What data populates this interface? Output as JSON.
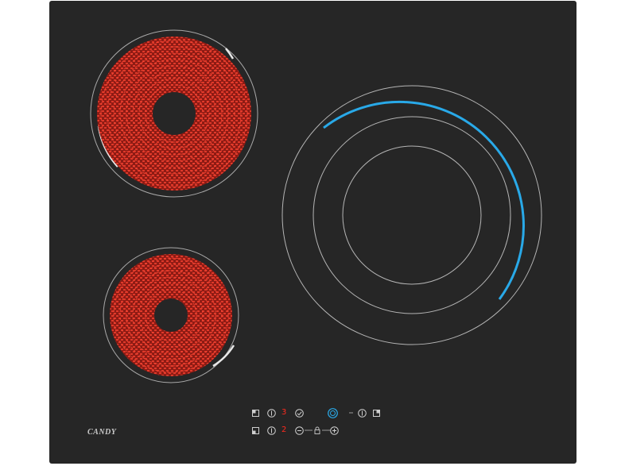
{
  "brand": {
    "logo_text": "CANDY"
  },
  "zones": {
    "top_left": {
      "state": "heating",
      "color": "#d0281c"
    },
    "bottom_left": {
      "state": "heating",
      "color": "#d0281c"
    },
    "right": {
      "state": "off",
      "indicator_color": "#29a9e8"
    }
  },
  "controls": {
    "row_top": {
      "level_digit": "3"
    },
    "row_bottom": {
      "level_digit": "2"
    }
  },
  "icons": [
    "zone-select-icon",
    "power-icon",
    "timer-check-icon",
    "zone-selected-icon",
    "minus-icon",
    "lock-icon",
    "plus-icon"
  ],
  "colors": {
    "glass": "#262626",
    "zone_ring": "#b5b5b5",
    "heat": "#d0281c",
    "accent": "#29a9e8"
  }
}
